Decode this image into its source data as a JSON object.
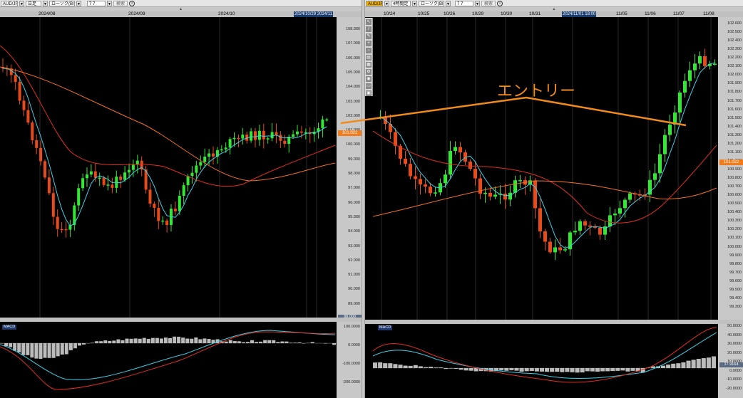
{
  "left_chart": {
    "toolbar": {
      "symbol": "AUD/JPY",
      "period": "日足",
      "chart_type": "ローソク(BID)",
      "count": "7 7",
      "search_label": "検索",
      "info": "i"
    },
    "dates": [
      {
        "text": "2024/08"
      },
      {
        "text": "2024/09"
      },
      {
        "text": "2024/10"
      }
    ],
    "cursor_date": "2024/10/29 2024/11",
    "price_labels": [
      "108.000",
      "107.000",
      "106.000",
      "105.000",
      "104.000",
      "103.000",
      "102.000",
      "101.000",
      "100.000",
      "99.000",
      "98.000",
      "97.000",
      "96.000",
      "95.000",
      "94.000",
      "93.000",
      "92.000",
      "91.000",
      "90.000",
      "89.000"
    ],
    "current_price": "101.022",
    "bottom_tag": "88.000",
    "macd": {
      "label": "MACD",
      "axis": [
        "100.0000",
        "0.0000",
        "-100.0000",
        "-200.0000"
      ]
    }
  },
  "right_chart": {
    "toolbar": {
      "symbol": "AUD/JPY",
      "period": "4時間足",
      "chart_type": "ローソク(BID)",
      "count": "7 7",
      "search_label": "検索",
      "info": "i"
    },
    "dates": [
      {
        "text": "10/24"
      },
      {
        "text": "10/25"
      },
      {
        "text": "10/26"
      },
      {
        "text": "10/29"
      },
      {
        "text": "10/30"
      },
      {
        "text": "10/31"
      },
      {
        "text": "11/05"
      },
      {
        "text": "11/06"
      },
      {
        "text": "11/07"
      },
      {
        "text": "11/08"
      }
    ],
    "cursor_date": "2024/11/01 18:00",
    "price_labels": [
      "102.600",
      "102.500",
      "102.400",
      "102.300",
      "102.200",
      "102.100",
      "102.000",
      "101.900",
      "101.800",
      "101.700",
      "101.600",
      "101.500",
      "101.400",
      "101.300",
      "101.200",
      "101.100",
      "101.000",
      "100.900",
      "100.800",
      "100.700",
      "100.600",
      "100.500",
      "100.400",
      "100.300",
      "100.200",
      "100.100",
      "100.000",
      "99.900",
      "99.800",
      "99.700",
      "99.600",
      "99.500",
      "99.400",
      "99.300"
    ],
    "current_price": "101.022",
    "macd": {
      "label": "MACD",
      "axis": [
        "50.0000",
        "40.0000",
        "30.0000",
        "20.0000",
        "10.0000",
        "0.0000",
        "-10.0000",
        "-20.0000"
      ],
      "tag": "17.9164"
    }
  },
  "annotation": {
    "text": "エントリー",
    "color": "#f08a1a"
  },
  "colors": {
    "bull": "#33e833",
    "bear": "#e84a1a",
    "ma_fast": "#40d0e8",
    "ma_mid": "#e03020",
    "ma_slow": "#f07020",
    "background": "#000000"
  }
}
